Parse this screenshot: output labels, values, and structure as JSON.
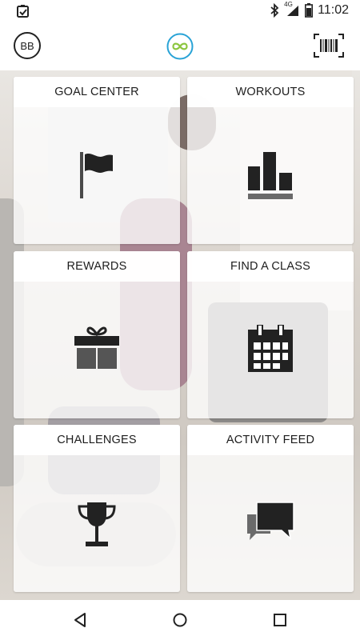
{
  "status_bar": {
    "time": "11:02",
    "network": "4G",
    "icons": [
      "task-check-icon",
      "bluetooth-icon",
      "signal-icon",
      "battery-icon"
    ]
  },
  "app_bar": {
    "avatar_initials": "BB",
    "logo": "infinity-logo-icon",
    "barcode": "barcode-scan-icon",
    "accent_color": "#29a3d6"
  },
  "tiles": [
    {
      "label": "GOAL CENTER",
      "icon": "flag-icon"
    },
    {
      "label": "WORKOUTS",
      "icon": "bar-chart-icon"
    },
    {
      "label": "REWARDS",
      "icon": "gift-icon"
    },
    {
      "label": "FIND A CLASS",
      "icon": "calendar-icon"
    },
    {
      "label": "CHALLENGES",
      "icon": "trophy-icon"
    },
    {
      "label": "ACTIVITY FEED",
      "icon": "chat-bubbles-icon"
    }
  ],
  "nav_bar": {
    "buttons": [
      "back-icon",
      "home-icon",
      "recents-icon"
    ]
  }
}
